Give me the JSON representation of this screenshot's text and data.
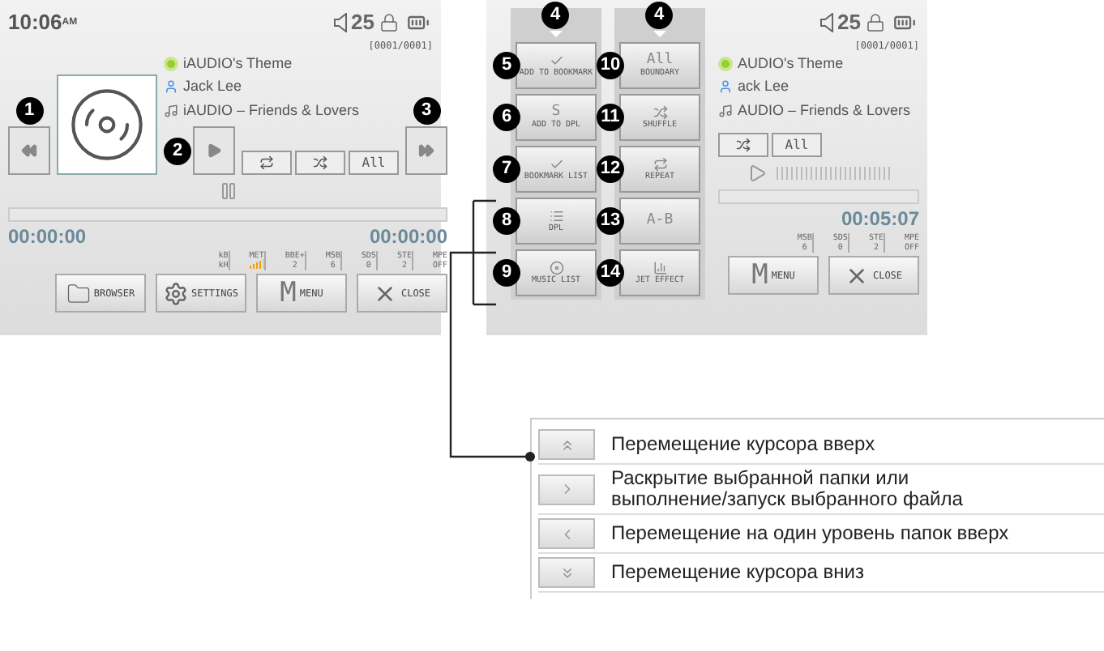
{
  "screens": [
    {
      "status": {
        "time": "10:06",
        "ampm": "AM",
        "volume": "25",
        "counter": "[0001/0001]"
      },
      "art": true,
      "nav": [
        {
          "kind": "rewind",
          "marker": "1"
        },
        {
          "kind": "play",
          "marker": "2"
        },
        {
          "kind": "forward",
          "marker": "3"
        }
      ],
      "tracks": [
        {
          "kind": "title",
          "text": "iAUDIO's Theme"
        },
        {
          "kind": "artist",
          "text": "Jack Lee"
        },
        {
          "kind": "album",
          "text": "iAUDIO – Friends & Lovers"
        }
      ],
      "modes": [
        {
          "kind": "repeat"
        },
        {
          "kind": "shuffle"
        },
        {
          "kind": "text",
          "label": "All"
        }
      ],
      "playback": {
        "kind": "paused"
      },
      "progress": {
        "level": 0
      },
      "times": [
        "00:00:00",
        "00:00:00"
      ],
      "effects": [
        {
          "kind": "text",
          "label": "kB",
          "value": "kH"
        },
        {
          "kind": "meter",
          "label": "MET",
          "level": 0.8
        },
        {
          "kind": "text",
          "label": "BBE+",
          "value": "2"
        },
        {
          "kind": "text",
          "label": "MSB",
          "value": "6"
        },
        {
          "kind": "text",
          "label": "SDS",
          "value": "0"
        },
        {
          "kind": "text",
          "label": "STE",
          "value": "2"
        },
        {
          "kind": "text",
          "label": "MPE",
          "value": "OFF"
        }
      ],
      "buttons": [
        {
          "kind": "folder",
          "label": "BROWSER"
        },
        {
          "kind": "gear",
          "label": "SETTINGS"
        },
        {
          "kind": "menu",
          "glyph": "M",
          "label": "MENU"
        },
        {
          "kind": "close",
          "label": "CLOSE"
        }
      ]
    },
    {
      "status": {
        "volume": "25",
        "counter": "[0001/0001]"
      },
      "menu": [
        {
          "marker": "4",
          "items": [
            {
              "marker": "5",
              "kind": "check",
              "label": "ADD TO BOOKMARK"
            },
            {
              "marker": "6",
              "kind": "glyph",
              "glyph": "S",
              "label": "ADD TO DPL"
            },
            {
              "marker": "7",
              "kind": "check",
              "label": "BOOKMARK LIST"
            },
            {
              "marker": "8",
              "kind": "list",
              "label": "DPL"
            },
            {
              "marker": "9",
              "kind": "disc",
              "label": "MUSIC LIST"
            }
          ]
        },
        {
          "marker": "4",
          "items": [
            {
              "marker": "10",
              "kind": "glyph",
              "glyph": "All",
              "label": "BOUNDARY"
            },
            {
              "marker": "11",
              "kind": "shuffle",
              "label": "SHUFFLE"
            },
            {
              "marker": "12",
              "kind": "repeat",
              "label": "REPEAT"
            },
            {
              "marker": "13",
              "kind": "glyph",
              "glyph": "A-B"
            },
            {
              "marker": "14",
              "kind": "bars",
              "label": "JET EFFECT"
            }
          ]
        }
      ],
      "tracks": [
        {
          "kind": "title",
          "text": "AUDIO's Theme"
        },
        {
          "kind": "artist",
          "text": "ack Lee"
        },
        {
          "kind": "album",
          "text": "AUDIO – Friends & Lovers"
        }
      ],
      "modes": [
        {
          "kind": "shuffle"
        },
        {
          "kind": "text",
          "label": "All"
        }
      ],
      "playback": {
        "kind": "stopped"
      },
      "progress": {
        "level": 0
      },
      "times": [
        "00:05:07"
      ],
      "effects": [
        {
          "kind": "text",
          "label": "MSB",
          "value": "6"
        },
        {
          "kind": "text",
          "label": "SDS",
          "value": "0"
        },
        {
          "kind": "text",
          "label": "STE",
          "value": "2"
        },
        {
          "kind": "text",
          "label": "MPE",
          "value": "OFF"
        }
      ],
      "buttons": [
        {
          "kind": "menu",
          "glyph": "M",
          "label": "MENU"
        },
        {
          "kind": "close",
          "label": "CLOSE"
        }
      ]
    }
  ],
  "legend": [
    {
      "kind": "up",
      "text": "Перемещение курсора вверх"
    },
    {
      "kind": "right",
      "text": "Раскрытие выбранной папки или выполнение/запуск выбранного файла"
    },
    {
      "kind": "left",
      "text": "Перемещение на один уровень папок вверх"
    },
    {
      "kind": "down",
      "text": "Перемещение курсора вниз"
    }
  ]
}
